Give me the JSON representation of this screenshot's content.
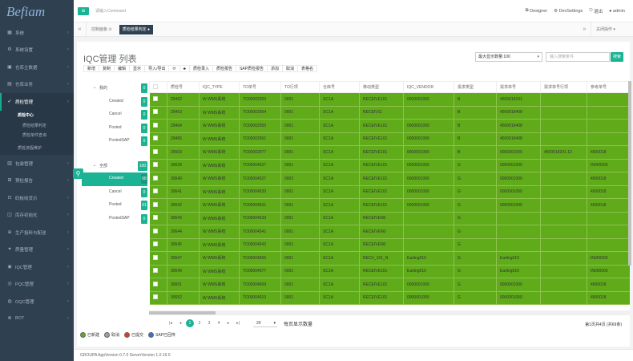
{
  "app": {
    "logo": "Befiam"
  },
  "sidebar": {
    "items": [
      {
        "label": "系统"
      },
      {
        "label": "系统设置"
      },
      {
        "label": "仓库主数据"
      },
      {
        "label": "仓库业务"
      },
      {
        "label": "质检管理",
        "active": true
      },
      {
        "label": "质检中心",
        "sub": true,
        "on": true
      },
      {
        "label": "质检结果判定",
        "sub2": true
      },
      {
        "label": "质检单件查询",
        "sub2": true
      },
      {
        "label": "质检流程维护",
        "sub": true
      },
      {
        "label": "包装管理"
      },
      {
        "label": "预检报告"
      },
      {
        "label": "码板收货示"
      },
      {
        "label": "库存初始化"
      },
      {
        "label": "生产投料与配送"
      },
      {
        "label": "质量管理"
      },
      {
        "label": "IQC管理"
      },
      {
        "label": "PQC管理"
      },
      {
        "label": "OQC管理"
      },
      {
        "label": "BOT"
      }
    ]
  },
  "topbar": {
    "search_placeholder": "请输入Command",
    "designer": "Designer",
    "devsettings": "DevSettings",
    "logout": "退出",
    "user": "admin"
  },
  "tabs": {
    "items": [
      {
        "label": "控制面板"
      },
      {
        "label": "质检结果判定"
      }
    ],
    "close_ops": "关闭操作"
  },
  "page": {
    "title": "IQC管理 列表",
    "max_show": "最大显示数量:100",
    "search_placeholder": "输入搜索条件",
    "search_btn": "搜索"
  },
  "toolbar": [
    "新增",
    "复制",
    "编辑",
    "显示",
    "导入/导出",
    "⟳",
    "♣",
    "质检录入",
    "质检报告",
    "SAP质检报告",
    "添加",
    "取消",
    "表格名"
  ],
  "tree": {
    "groups": [
      {
        "label": "我的",
        "badge": "0",
        "children": [
          {
            "label": "Created",
            "badge": "0"
          },
          {
            "label": "Cancel",
            "badge": "0"
          },
          {
            "label": "Posted",
            "badge": "0"
          },
          {
            "label": "PostedSAP",
            "badge": "0"
          }
        ]
      },
      {
        "label": "全部",
        "badge": "100",
        "children": [
          {
            "label": "Created",
            "badge": "68",
            "sel": true
          },
          {
            "label": "Cancel",
            "badge": "0"
          },
          {
            "label": "Posted",
            "badge": "61"
          },
          {
            "label": "PostedSAP",
            "badge": "0"
          }
        ]
      }
    ]
  },
  "grid": {
    "columns": [
      "质检号",
      "IQC_TYPE",
      "TO单号",
      "TO行项",
      "仓库号",
      "移动类型",
      "IQC_VENDOR",
      "需求类型",
      "需求单号",
      "需求单号行项",
      "参考单号"
    ],
    "rows": [
      [
        "29462",
        "W WMS系统",
        "TO00002553",
        "0001",
        "SC1A",
        "RECEIVE101",
        "0000001000",
        "B",
        "4500018241",
        "",
        ""
      ],
      [
        "29463",
        "W WMS系统",
        "TO00002554",
        "0001",
        "SC1A",
        "RECEIV11",
        "",
        "B",
        "4500018408",
        "",
        ""
      ],
      [
        "29464",
        "W WMS系统",
        "TO00002555",
        "0001",
        "SC1A",
        "RECEIVE101",
        "0000001000",
        "B",
        "4500018408",
        "",
        ""
      ],
      [
        "29465",
        "W WMS系统",
        "TO00002561",
        "0001",
        "SC1A",
        "RECEIVE101",
        "0000001000",
        "B",
        "4500018408",
        "",
        ""
      ],
      [
        "29503",
        "W WMS系统",
        "TO00002977",
        "0001",
        "SC1A",
        "RECEIVE101",
        "0000001000",
        "B",
        "0000001000",
        "4500018241.10",
        "4500018"
      ],
      [
        "30639",
        "W WMS系统",
        "TO00004527",
        "0001",
        "SC1A",
        "RECEIVE101",
        "0000001000",
        "G",
        "0000001000",
        "",
        "IN000000"
      ],
      [
        "30640",
        "W WMS系统",
        "TO00004527",
        "0002",
        "SC1A",
        "RECEIVE101",
        "0000001000",
        "G",
        "0000001000",
        "",
        "4500018"
      ],
      [
        "30641",
        "W WMS系统",
        "TO00004530",
        "0001",
        "SC1A",
        "RECEIVE101",
        "0000001000",
        "G",
        "0000001000",
        "",
        "4500018"
      ],
      [
        "30642",
        "W WMS系统",
        "TO00004531",
        "0001",
        "SC1A",
        "RECEIVE101",
        "0000001000",
        "G",
        "0000001000",
        "",
        "4500018"
      ],
      [
        "30643",
        "W WMS系统",
        "TO00004539",
        "0001",
        "SC1A",
        "RECEIVEN0",
        "",
        "G",
        "",
        "",
        ""
      ],
      [
        "30644",
        "W WMS系统",
        "TO00004541",
        "0001",
        "SC1A",
        "RECEIVEN0",
        "",
        "G",
        "",
        "",
        ""
      ],
      [
        "30645",
        "W WMS系统",
        "TO00004542",
        "0001",
        "SC1A",
        "RECEIVEN0",
        "",
        "G",
        "",
        "",
        ""
      ],
      [
        "30647",
        "W WMS系统",
        "TO00004555",
        "0001",
        "SC1A",
        "RECV_101_N",
        "Earling010",
        "G",
        "Earling010",
        "",
        "IN000000"
      ],
      [
        "30649",
        "W WMS系统",
        "TO00004577",
        "0001",
        "SC1A",
        "RECEIVE101",
        "Earling010",
        "G",
        "Earling010",
        "",
        "IN000000"
      ],
      [
        "30651",
        "W WMS系统",
        "TO00004609",
        "0001",
        "SC1A",
        "RECEIVE101",
        "0000001000",
        "G",
        "0000001000",
        "",
        "4500018"
      ],
      [
        "30652",
        "W WMS系统",
        "TO00004610",
        "0001",
        "SC1A",
        "RECEIVE101",
        "0000001000",
        "G",
        "0000001000",
        "",
        "4500018"
      ]
    ]
  },
  "pager": {
    "pages": [
      "1",
      "2",
      "3",
      "4"
    ],
    "per_page": "20",
    "per_page_label": "每页显示数量",
    "info": "第1页共4页 (共69条)"
  },
  "legend": [
    {
      "label": "已新建",
      "color": "#5fab1a"
    },
    {
      "label": "取消",
      "color": "#a0a0a0"
    },
    {
      "label": "已提交",
      "color": "#e63a1a"
    },
    {
      "label": "SAP已回传",
      "color": "#3a6fd6"
    }
  ],
  "footer": {
    "text": "GROUPA AppVersion 0.7.0 ServerVersion 1.0.19.0"
  }
}
